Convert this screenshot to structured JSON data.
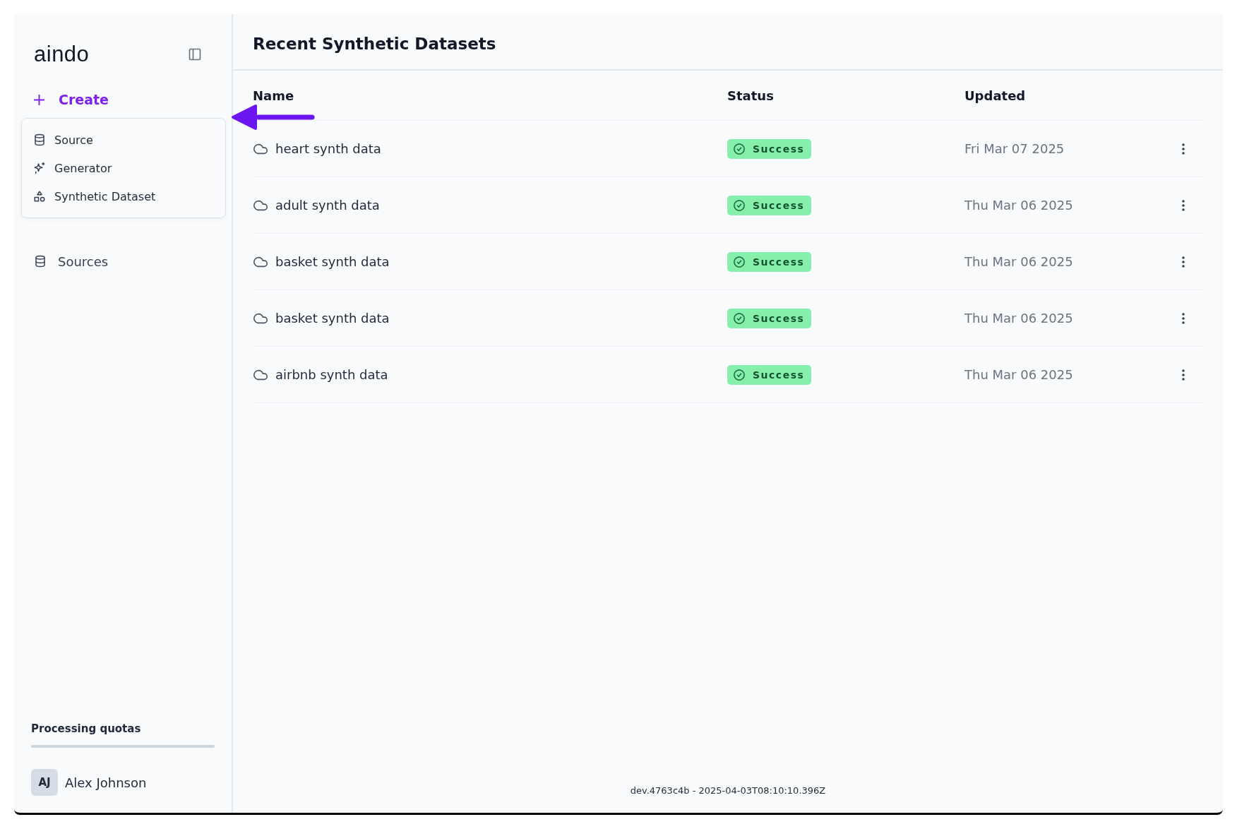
{
  "sidebar": {
    "logo": "aindo",
    "create": {
      "label": "Create",
      "expanded": true
    },
    "create_menu": [
      {
        "label": "Source",
        "kind": "source"
      },
      {
        "label": "Generator",
        "kind": "generator"
      },
      {
        "label": "Synthetic Dataset",
        "kind": "dataset"
      }
    ],
    "nav": [
      {
        "label": "Sources",
        "kind": "source"
      }
    ],
    "quota": {
      "label": "Processing quotas"
    },
    "user": {
      "initials": "AJ",
      "name": "Alex Johnson"
    }
  },
  "main": {
    "title": "Recent Synthetic Datasets",
    "columns": [
      "Name",
      "Status",
      "Updated"
    ],
    "rows": [
      {
        "name": "heart synth data",
        "status": "Success",
        "updated": "Fri Mar 07 2025"
      },
      {
        "name": "adult synth data",
        "status": "Success",
        "updated": "Thu Mar 06 2025"
      },
      {
        "name": "basket synth data",
        "status": "Success",
        "updated": "Thu Mar 06 2025"
      },
      {
        "name": "basket synth data",
        "status": "Success",
        "updated": "Thu Mar 06 2025"
      },
      {
        "name": "airbnb synth data",
        "status": "Success",
        "updated": "Thu Mar 06 2025"
      }
    ],
    "footer": "dev.4763c4b - 2025-04-03T08:10:10.396Z"
  }
}
